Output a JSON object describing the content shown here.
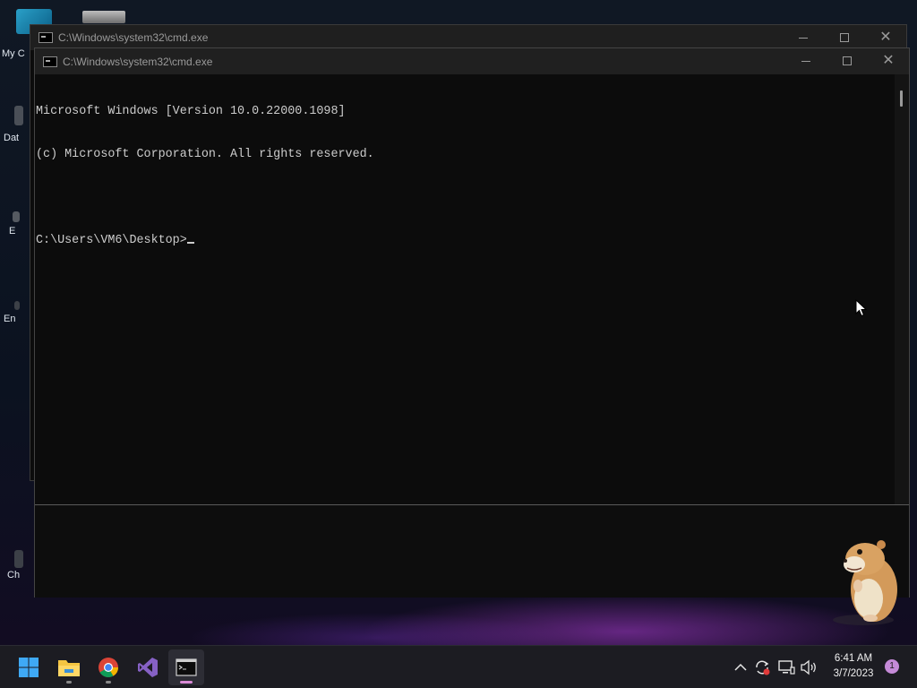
{
  "desktop": {
    "icons": [
      {
        "label": "My C"
      },
      {
        "label": "Dat"
      },
      {
        "label": "E"
      },
      {
        "label": "En"
      },
      {
        "label": "Ch"
      }
    ]
  },
  "back_window": {
    "title": "C:\\Windows\\system32\\cmd.exe"
  },
  "front_window": {
    "title": "C:\\Windows\\system32\\cmd.exe",
    "console_lines": [
      "Microsoft Windows [Version 10.0.22000.1098]",
      "(c) Microsoft Corporation. All rights reserved.",
      "",
      "C:\\Users\\VM6\\Desktop>"
    ]
  },
  "taskbar": {
    "apps": [
      {
        "name": "start",
        "icon": "windows-logo-icon"
      },
      {
        "name": "file-explorer",
        "icon": "folder-icon"
      },
      {
        "name": "chrome",
        "icon": "chrome-icon"
      },
      {
        "name": "visual-studio",
        "icon": "visual-studio-icon"
      },
      {
        "name": "cmd",
        "icon": "terminal-icon"
      }
    ],
    "time": "6:41 AM",
    "date": "3/7/2023",
    "notification_count": "1"
  },
  "colors": {
    "accent_pink": "#d98ad6",
    "console_bg": "#0c0c0c",
    "console_text": "#cccccc"
  }
}
